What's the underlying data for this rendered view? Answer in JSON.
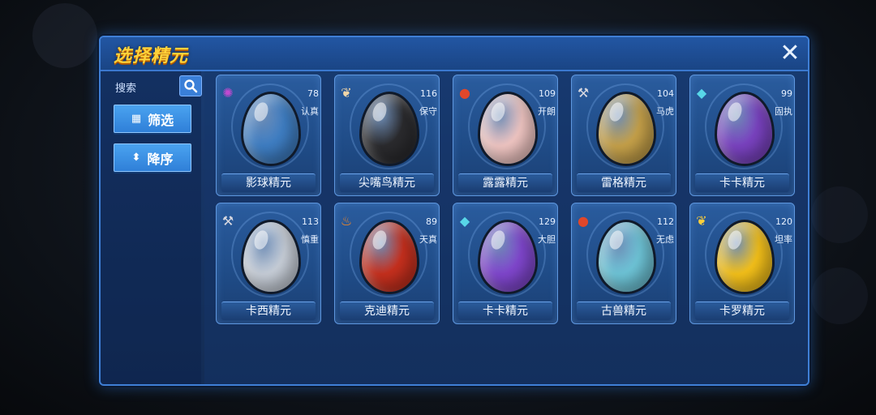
{
  "dialog": {
    "title": "选择精元",
    "close_label": "✕"
  },
  "sidebar": {
    "search_label": "搜索",
    "filter_label": "筛选",
    "sort_label": "降序"
  },
  "cards": [
    {
      "name": "影球精元",
      "number": "78",
      "nature": "认真",
      "icon": "purple-swirl-icon",
      "glyph": "✺",
      "icon_color": "#c04ad0",
      "egg_color": "#3f7fc5"
    },
    {
      "name": "尖嘴鸟精元",
      "number": "116",
      "nature": "保守",
      "icon": "wing-icon",
      "glyph": "❦",
      "icon_color": "#f2d6a8",
      "egg_color": "#2b2b2e"
    },
    {
      "name": "露露精元",
      "number": "109",
      "nature": "开朗",
      "icon": "fire-face-icon",
      "glyph": "●",
      "icon_color": "#e0472a",
      "egg_color": "#f2c7c4"
    },
    {
      "name": "雷格精元",
      "number": "104",
      "nature": "马虎",
      "icon": "wrench-icon",
      "glyph": "⚒",
      "icon_color": "#d8d8e0",
      "egg_color": "#c7a24a"
    },
    {
      "name": "卡卡精元",
      "number": "99",
      "nature": "固执",
      "icon": "crystal-icon",
      "glyph": "◆",
      "icon_color": "#58d7e8",
      "egg_color": "#7b43c2"
    },
    {
      "name": "卡西精元",
      "number": "113",
      "nature": "慎重",
      "icon": "wrench-icon",
      "glyph": "⚒",
      "icon_color": "#d8d8e0",
      "egg_color": "#c9d0da"
    },
    {
      "name": "克迪精元",
      "number": "89",
      "nature": "天真",
      "icon": "flame-icon",
      "glyph": "♨",
      "icon_color": "#ff8a1e",
      "egg_color": "#c8301e"
    },
    {
      "name": "卡卡精元",
      "number": "129",
      "nature": "大胆",
      "icon": "crystal-icon",
      "glyph": "◆",
      "icon_color": "#58d7e8",
      "egg_color": "#8147cf"
    },
    {
      "name": "古兽精元",
      "number": "112",
      "nature": "无虑",
      "icon": "fire-face-icon",
      "glyph": "●",
      "icon_color": "#e0472a",
      "egg_color": "#6fc6d9"
    },
    {
      "name": "卡罗精元",
      "number": "120",
      "nature": "坦率",
      "icon": "wing-icon",
      "glyph": "❦",
      "icon_color": "#ffcf3a",
      "egg_color": "#f6c21a"
    }
  ]
}
